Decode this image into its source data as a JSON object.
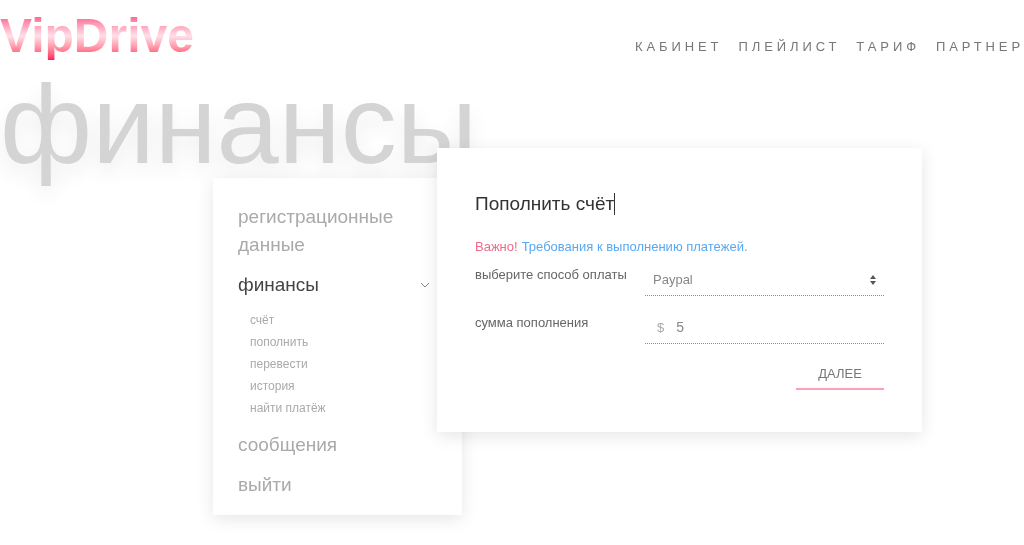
{
  "logo": "VipDrive",
  "nav": [
    "КАБИНЕТ",
    "ПЛЕЙЛИСТ",
    "ТАРИФ",
    "ПАРТНЕР"
  ],
  "page_heading": "финансы",
  "sidebar": {
    "items": [
      {
        "label": "регистрационные данные",
        "expanded": false
      },
      {
        "label": "финансы",
        "expanded": true,
        "children": [
          {
            "label": "счёт"
          },
          {
            "label": "пополнить"
          },
          {
            "label": "перевести"
          },
          {
            "label": "история"
          },
          {
            "label": "найти платёж"
          }
        ]
      },
      {
        "label": "сообщения",
        "expanded": false
      },
      {
        "label": "выйти",
        "expanded": false
      }
    ]
  },
  "form": {
    "title": "Пополнить счёт",
    "notice": {
      "label": "Важно!",
      "link": "Требования к выполнению платежей."
    },
    "fields": [
      {
        "kind": "select",
        "label": "выберите способ оплаты",
        "value": "Paypal"
      },
      {
        "kind": "amount",
        "label": "сумма пополнения",
        "prefix": "$",
        "value": "5"
      }
    ],
    "button": "ДАЛЕЕ"
  }
}
